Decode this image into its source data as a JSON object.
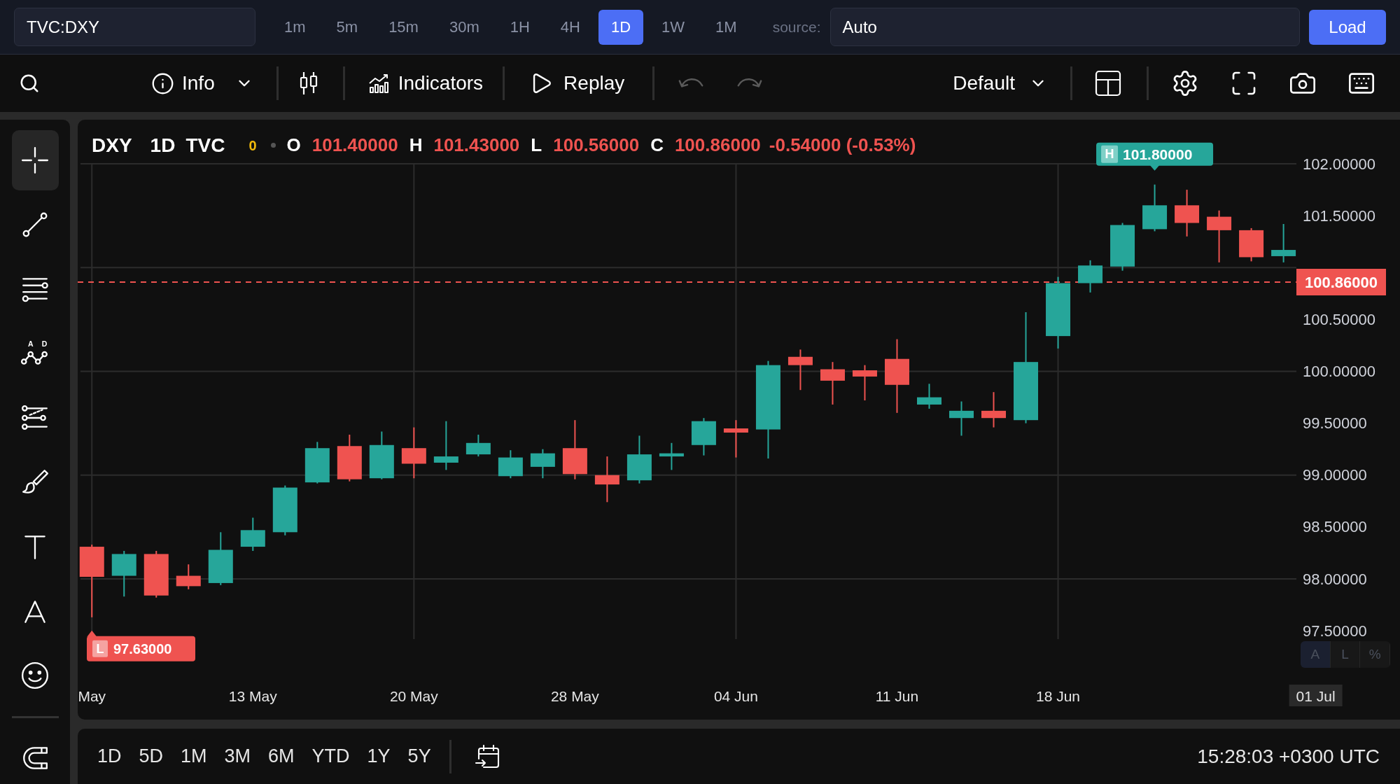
{
  "top_bar": {
    "symbol_field": {
      "value": "TVC:DXY"
    },
    "timeframes": [
      {
        "label": "1m",
        "selected": false
      },
      {
        "label": "5m",
        "selected": false
      },
      {
        "label": "15m",
        "selected": false
      },
      {
        "label": "30m",
        "selected": false
      },
      {
        "label": "1H",
        "selected": false
      },
      {
        "label": "4H",
        "selected": false
      },
      {
        "label": "1D",
        "selected": true
      },
      {
        "label": "1W",
        "selected": false
      },
      {
        "label": "1M",
        "selected": false
      }
    ],
    "source_label": "source:",
    "source_field": {
      "value": "Auto"
    },
    "load_button": "Load"
  },
  "toolbar": {
    "info": "Info",
    "indicators": "Indicators",
    "replay": "Replay",
    "undo": {
      "disabled": true
    },
    "redo": {
      "disabled": true
    },
    "chart_layout": "Default"
  },
  "drawing_tools": [
    {
      "selected": true
    },
    {
      "selected": false
    },
    {
      "selected": false
    },
    {
      "selected": false,
      "letters": [
        "A",
        "D"
      ]
    },
    {
      "selected": false
    },
    {
      "selected": false
    },
    {
      "selected": false
    },
    {
      "selected": false
    },
    {
      "selected": false
    }
  ],
  "chart": {
    "legend": {
      "symbol": "DXY",
      "interval": "1D",
      "exchange": "TVC",
      "count": "0",
      "fields": [
        {
          "label": "O",
          "value": "101.40000"
        },
        {
          "label": "H",
          "value": "101.43000"
        },
        {
          "label": "L",
          "value": "100.56000"
        },
        {
          "label": "C",
          "value": "100.86000"
        }
      ],
      "change": "-0.54000 (-0.53%)"
    },
    "high_marker": {
      "letter": "H",
      "value": "101.80000"
    },
    "price_axis": [
      "102.00000",
      "101.50000",
      "100.50000",
      "100.00000",
      "99.50000",
      "99.00000",
      "98.50000",
      "98.00000",
      "97.50000"
    ],
    "last_price": "100.86000",
    "low_marker": {
      "letter": "L",
      "value": "97.63000"
    },
    "scale_buttons": [
      {
        "label": "A",
        "selected": true
      },
      {
        "label": "L",
        "selected": false
      },
      {
        "label": "%",
        "selected": false
      }
    ],
    "date_axis": [
      "May",
      "13 May",
      "20 May",
      "28 May",
      "04 Jun",
      "11 Jun",
      "18 Jun"
    ],
    "time_label": "01 Jul"
  },
  "bottom_bar": {
    "ranges": [
      "1D",
      "5D",
      "1M",
      "3M",
      "6M",
      "YTD",
      "1Y",
      "5Y"
    ],
    "time": "15:28:03 +0300 UTC"
  }
}
